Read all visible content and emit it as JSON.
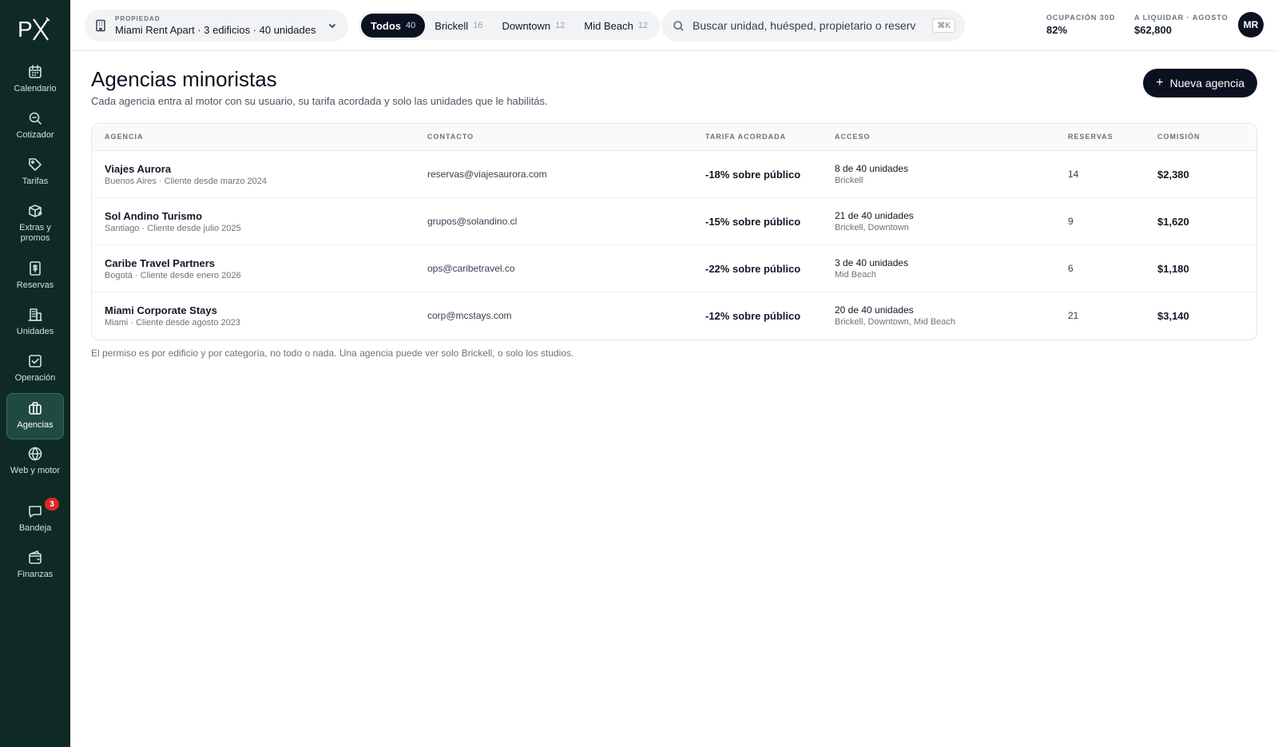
{
  "app": {
    "logo_text": "PX"
  },
  "sidebar": {
    "items": [
      {
        "label": "Calendario",
        "icon": "calendar-icon"
      },
      {
        "label": "Cotizador",
        "icon": "search-quote-icon"
      },
      {
        "label": "Tarifas",
        "icon": "tag-icon"
      },
      {
        "label": "Extras y promos",
        "icon": "box-plus-icon"
      },
      {
        "label": "Reservas",
        "icon": "receipt-icon"
      },
      {
        "label": "Unidades",
        "icon": "building-icon"
      },
      {
        "label": "Operación",
        "icon": "checklist-icon"
      },
      {
        "label": "Agencias",
        "icon": "briefcase-icon",
        "active": true
      },
      {
        "label": "Web y motor",
        "icon": "globe-icon"
      },
      {
        "label": "Bandeja",
        "icon": "chat-icon",
        "badge": "3"
      },
      {
        "label": "Finanzas",
        "icon": "wallet-icon"
      }
    ]
  },
  "topbar": {
    "property_label": "PROPIEDAD",
    "property_value": "Miami Rent Apart · 3 edificios · 40 unidades",
    "segments": [
      {
        "label": "Todos",
        "count": "40",
        "active": true
      },
      {
        "label": "Brickell",
        "count": "16"
      },
      {
        "label": "Downtown",
        "count": "12"
      },
      {
        "label": "Mid Beach",
        "count": "12"
      }
    ],
    "search_placeholder": "Buscar unidad, huésped, propietario o reserv",
    "search_shortcut": "⌘K",
    "stats": [
      {
        "label": "OCUPACIÓN 30D",
        "value": "82%"
      },
      {
        "label": "A LIQUIDAR · AGOSTO",
        "value": "$62,800"
      }
    ],
    "avatar_initials": "MR"
  },
  "page": {
    "title": "Agencias minoristas",
    "subtitle": "Cada agencia entra al motor con su usuario, su tarifa acordada y solo las unidades que le habilitás.",
    "new_button": "Nueva agencia",
    "footnote": "El permiso es por edificio y por categoría, no todo o nada. Una agencia puede ver solo Brickell, o solo los studios."
  },
  "table": {
    "headers": {
      "agency": "AGENCIA",
      "contact": "CONTACTO",
      "rate": "TARIFA ACORDADA",
      "access": "ACCESO",
      "bookings": "RESERVAS",
      "commission": "COMISIÓN"
    },
    "rows": [
      {
        "name": "Viajes Aurora",
        "meta": "Buenos Aires · Cliente desde marzo 2024",
        "contact": "reservas@viajesaurora.com",
        "rate": "-18% sobre público",
        "access": "8 de 40 unidades",
        "access_detail": "Brickell",
        "bookings": "14",
        "commission": "$2,380"
      },
      {
        "name": "Sol Andino Turismo",
        "meta": "Santiago · Cliente desde julio 2025",
        "contact": "grupos@solandino.cl",
        "rate": "-15% sobre público",
        "access": "21 de 40 unidades",
        "access_detail": "Brickell, Downtown",
        "bookings": "9",
        "commission": "$1,620"
      },
      {
        "name": "Caribe Travel Partners",
        "meta": "Bogotá · Cliente desde enero 2026",
        "contact": "ops@caribetravel.co",
        "rate": "-22% sobre público",
        "access": "3 de 40 unidades",
        "access_detail": "Mid Beach",
        "bookings": "6",
        "commission": "$1,180"
      },
      {
        "name": "Miami Corporate Stays",
        "meta": "Miami · Cliente desde agosto 2023",
        "contact": "corp@mcstays.com",
        "rate": "-12% sobre público",
        "access": "20 de 40 unidades",
        "access_detail": "Brickell, Downtown, Mid Beach",
        "bookings": "21",
        "commission": "$3,140"
      }
    ]
  }
}
